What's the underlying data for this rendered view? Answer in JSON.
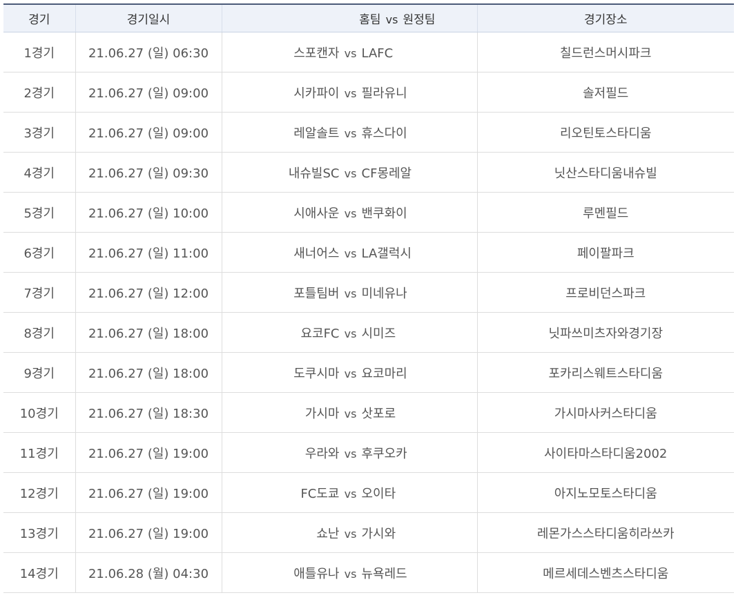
{
  "header": {
    "game": "경기",
    "datetime": "경기일시",
    "home_label": "홈팀",
    "vs": "vs",
    "away_label": "원정팀",
    "venue": "경기장소"
  },
  "rows": [
    {
      "game": "1경기",
      "datetime": "21.06.27 (일) 06:30",
      "home": "스포캔자",
      "vs": "vs",
      "away": "LAFC",
      "venue": "칠드런스머시파크"
    },
    {
      "game": "2경기",
      "datetime": "21.06.27 (일) 09:00",
      "home": "시카파이",
      "vs": "vs",
      "away": "필라유니",
      "venue": "솔저필드"
    },
    {
      "game": "3경기",
      "datetime": "21.06.27 (일) 09:00",
      "home": "레알솔트",
      "vs": "vs",
      "away": "휴스다이",
      "venue": "리오틴토스타디움"
    },
    {
      "game": "4경기",
      "datetime": "21.06.27 (일) 09:30",
      "home": "내슈빌SC",
      "vs": "vs",
      "away": "CF몽레알",
      "venue": "닛산스타디움내슈빌"
    },
    {
      "game": "5경기",
      "datetime": "21.06.27 (일) 10:00",
      "home": "시애사운",
      "vs": "vs",
      "away": "밴쿠화이",
      "venue": "루멘필드"
    },
    {
      "game": "6경기",
      "datetime": "21.06.27 (일) 11:00",
      "home": "새너어스",
      "vs": "vs",
      "away": "LA갤럭시",
      "venue": "페이팔파크"
    },
    {
      "game": "7경기",
      "datetime": "21.06.27 (일) 12:00",
      "home": "포틀팀버",
      "vs": "vs",
      "away": "미네유나",
      "venue": "프로비던스파크"
    },
    {
      "game": "8경기",
      "datetime": "21.06.27 (일) 18:00",
      "home": "요코FC",
      "vs": "vs",
      "away": "시미즈",
      "venue": "닛파쓰미츠자와경기장"
    },
    {
      "game": "9경기",
      "datetime": "21.06.27 (일) 18:00",
      "home": "도쿠시마",
      "vs": "vs",
      "away": "요코마리",
      "venue": "포카리스웨트스타디움"
    },
    {
      "game": "10경기",
      "datetime": "21.06.27 (일) 18:30",
      "home": "가시마",
      "vs": "vs",
      "away": "삿포로",
      "venue": "가시마사커스타디움"
    },
    {
      "game": "11경기",
      "datetime": "21.06.27 (일) 19:00",
      "home": "우라와",
      "vs": "vs",
      "away": "후쿠오카",
      "venue": "사이타마스타디움2002"
    },
    {
      "game": "12경기",
      "datetime": "21.06.27 (일) 19:00",
      "home": "FC도쿄",
      "vs": "vs",
      "away": "오이타",
      "venue": "아지노모토스타디움"
    },
    {
      "game": "13경기",
      "datetime": "21.06.27 (일) 19:00",
      "home": "쇼난",
      "vs": "vs",
      "away": "가시와",
      "venue": "레몬가스스타디움히라쓰카"
    },
    {
      "game": "14경기",
      "datetime": "21.06.28 (월) 04:30",
      "home": "애틀유나",
      "vs": "vs",
      "away": "뉴욕레드",
      "venue": "메르세데스벤츠스타디움"
    }
  ]
}
